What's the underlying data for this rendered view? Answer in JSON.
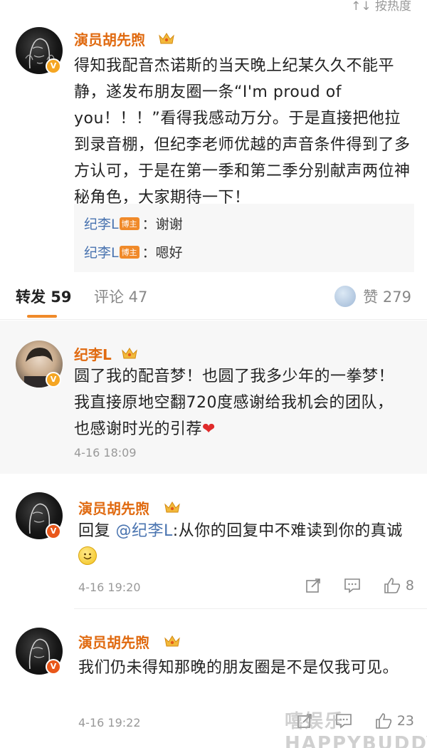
{
  "header": {
    "cut_text": "↑↓ 按热度"
  },
  "post": {
    "username": "演员胡先煦",
    "text": "得知我配音杰诺斯的当天晚上纪某久久不能平静，遂发布朋友圈一条“I'm proud of you！！！”看得我感动万分。于是直接把他拉到录音棚，但纪李老师优越的声音条件得到了多方认可，于是在第一季和第二季分别献声两位神秘角色，大家期待一下！",
    "replies": [
      {
        "name": "纪李L",
        "badge": "博主",
        "text": "：谢谢"
      },
      {
        "name": "纪李L",
        "badge": "博主",
        "text": "：嗯好"
      }
    ]
  },
  "tabs": {
    "repost": "转发 59",
    "comment": "评论 47",
    "like": "赞 279"
  },
  "comments": [
    {
      "username": "纪李L",
      "text": "圆了我的配音梦！也圆了我多少年的一拳梦！我直接原地空翻720度感谢给我机会的团队，也感谢时光的引荐",
      "emoji": "❤",
      "time": "4-16 18:09"
    },
    {
      "username": "演员胡先煦",
      "reply_prefix": "回复",
      "mention": "@纪李L",
      "text": ":从你的回复中不难读到你的真诚",
      "time": "4-16 19:20",
      "likes": "8"
    },
    {
      "username": "演员胡先煦",
      "text": "我们仍未得知那晚的朋友圈是不是仅我可见。",
      "time": "4-16 19:22",
      "likes": "23"
    }
  ],
  "watermark": "嘻娱乐 HAPPYBUDDY",
  "colors": {
    "username": "#e06a10",
    "mention": "#4a74b0",
    "tab_accent": "#f08a2a",
    "badge": "#f08a2a"
  }
}
